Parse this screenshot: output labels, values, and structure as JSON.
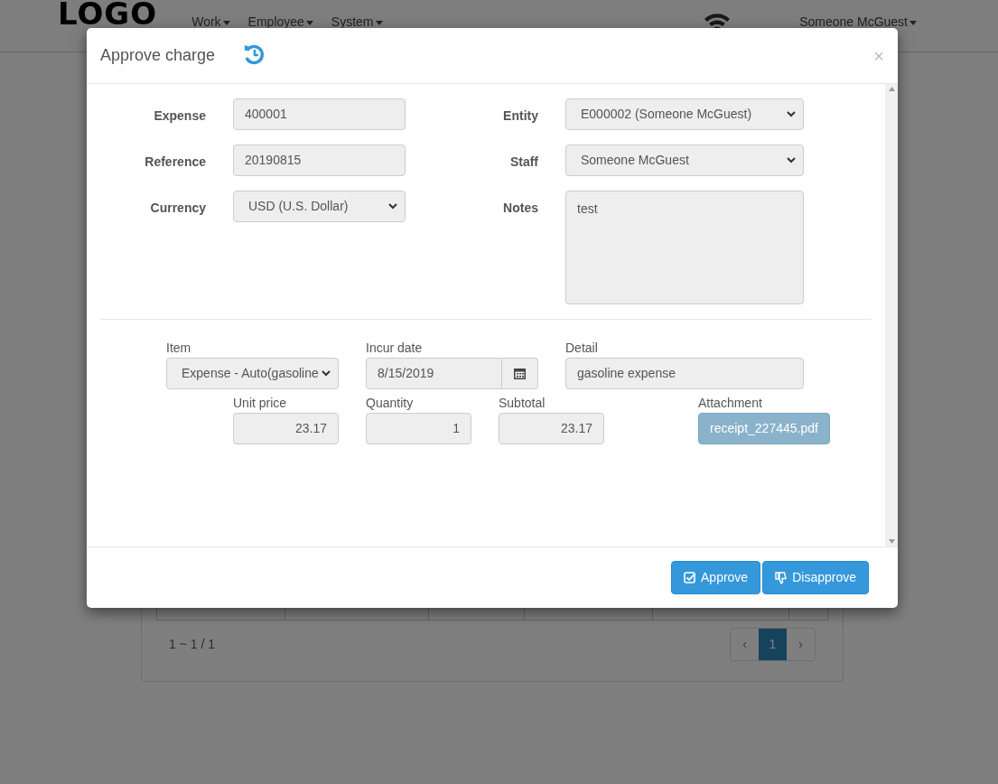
{
  "navbar": {
    "logo": "LOGO",
    "menus": [
      {
        "label": "Work"
      },
      {
        "label": "Employee"
      },
      {
        "label": "System"
      }
    ],
    "user": "Someone McGuest"
  },
  "list": {
    "pager_info": "1 ~ 1 / 1",
    "pages": [
      {
        "label": "‹",
        "selected": false
      },
      {
        "label": "1",
        "selected": true
      },
      {
        "label": "›",
        "selected": false
      }
    ]
  },
  "modal": {
    "title": "Approve charge",
    "close": "×",
    "left_fields": [
      {
        "label": "Expense",
        "value": "400001",
        "kind": "input"
      },
      {
        "label": "Reference",
        "value": "20190815",
        "kind": "input"
      },
      {
        "label": "Currency",
        "value": "USD (U.S. Dollar)",
        "kind": "select"
      }
    ],
    "right_fields": [
      {
        "label": "Entity",
        "value": "E000002 (Someone McGuest)",
        "kind": "select"
      },
      {
        "label": "Staff",
        "value": "Someone McGuest",
        "kind": "select"
      },
      {
        "label": "Notes",
        "value": "test",
        "kind": "textarea"
      }
    ],
    "line_item": {
      "item": {
        "label": "Item",
        "value": "Expense - Auto(gasoline"
      },
      "incur_date": {
        "label": "Incur date",
        "value": "8/15/2019"
      },
      "detail": {
        "label": "Detail",
        "value": "gasoline expense"
      },
      "unit_price": {
        "label": "Unit price",
        "value": "23.17"
      },
      "quantity": {
        "label": "Quantity",
        "value": "1"
      },
      "subtotal": {
        "label": "Subtotal",
        "value": "23.17"
      },
      "attachment": {
        "label": "Attachment",
        "value": "receipt_227445.pdf"
      }
    },
    "buttons": [
      {
        "label": "Approve",
        "kind": "approve"
      },
      {
        "label": "Disapprove",
        "kind": "disapprove"
      }
    ]
  }
}
